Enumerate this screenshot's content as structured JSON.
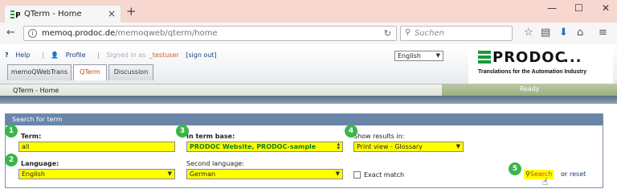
{
  "browser": {
    "tab_title": "QTerm - Home",
    "url_host": "memoq.prodoc.de",
    "url_path": "/memoqweb/qterm/home",
    "search_placeholder": "Suchen"
  },
  "app": {
    "help_label": "Help",
    "profile_label": "Profile",
    "signed_in_label": "Signed in as",
    "username": "_testuser",
    "signout_label": "[sign out]",
    "ui_language": "English",
    "logo": {
      "brand": "PRODOC",
      "tagline": "Translations for the Automation Industry"
    },
    "nav_tabs": [
      "memoQWebTrans",
      "QTerm",
      "Discussion"
    ],
    "active_tab": "QTerm",
    "breadcrumb": "QTerm - Home",
    "status": "Ready"
  },
  "search_panel": {
    "title": "Search for term",
    "term_label": "Term:",
    "term_value": "all",
    "termbase_label": "In term base:",
    "termbase_value": "PRODOC Website, PRODOC-sample",
    "results_label": "Show results in:",
    "results_value": "Print view - Glossary",
    "language_label": "Language:",
    "language_value": "English",
    "second_language_label": "Second language:",
    "second_language_value": "German",
    "exact_match_label": "Exact match",
    "search_label": "Search",
    "or_label": "or",
    "reset_label": "reset"
  },
  "callouts": [
    "1",
    "2",
    "3",
    "4",
    "5"
  ],
  "colors": {
    "highlight": "#ffff00",
    "callout": "#3ab54a",
    "panel_header": "#6985a8",
    "accent": "#c24b12"
  }
}
